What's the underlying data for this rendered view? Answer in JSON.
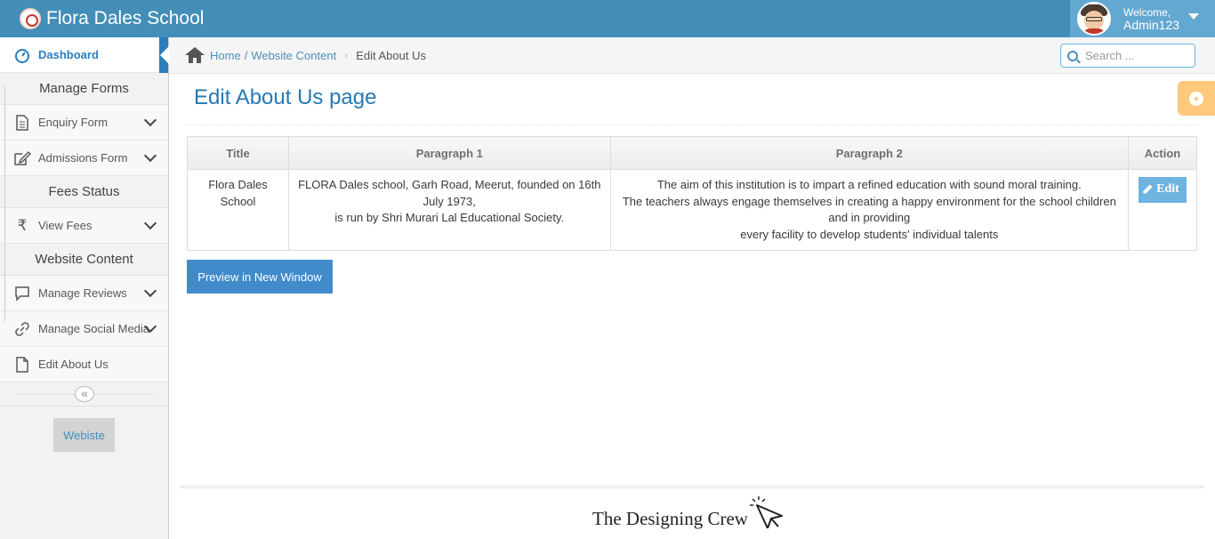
{
  "app": {
    "brand": "Flora Dales School",
    "welcome": "Welcome,",
    "username": "Admin123"
  },
  "sidebar": {
    "dashboard": "Dashboard",
    "sections": [
      {
        "header": "Manage Forms",
        "items": [
          "Enquiry Form",
          "Admissions Form"
        ]
      },
      {
        "header": "Fees Status",
        "items": [
          "View Fees"
        ]
      },
      {
        "header": "Website Content",
        "items": [
          "Manage Reviews",
          "Manage Social Media",
          "Edit About Us"
        ]
      }
    ],
    "collapse_icon": "«",
    "website_button": "Webiste"
  },
  "breadcrumb": {
    "home": "Home",
    "parent": "Website Content",
    "separator": "/",
    "chevron": "›",
    "current": "Edit About Us"
  },
  "search": {
    "placeholder": "Search ..."
  },
  "page": {
    "title": "Edit About Us page"
  },
  "table": {
    "headers": [
      "Title",
      "Paragraph 1",
      "Paragraph 2",
      "Action"
    ],
    "row": {
      "title": "Flora Dales School",
      "paragraph1": [
        "FLORA Dales school, Garh Road, Meerut, founded on 16th July 1973,",
        "is run by Shri Murari Lal Educational Society."
      ],
      "paragraph2": [
        "The aim of this institution is to impart a refined education with sound moral training.",
        "The teachers always engage themselves in creating a happy environment for the school children and in providing",
        "every facility to develop students' individual talents"
      ],
      "action": "Edit"
    }
  },
  "preview_button": "Preview in New Window",
  "footer": {
    "brand": "The Designing Crew"
  },
  "colors": {
    "navbar": "#438eb9",
    "accent": "#2679b5",
    "settings": "#ffb752"
  }
}
